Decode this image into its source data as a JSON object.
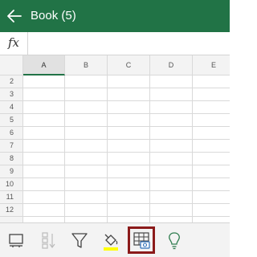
{
  "window": {
    "title": "Book (5)"
  },
  "formula_bar": {
    "fx_label": "fx",
    "value": ""
  },
  "grid": {
    "columns": [
      "A",
      "B",
      "C",
      "D",
      "E"
    ],
    "rows": [
      "2",
      "3",
      "4",
      "5",
      "6",
      "7",
      "8",
      "9",
      "10",
      "11",
      "12"
    ],
    "active_column": "A"
  },
  "toolbar": {
    "items": [
      {
        "icon": "keyboard-view-icon",
        "state": "normal"
      },
      {
        "icon": "sort-icon",
        "state": "disabled"
      },
      {
        "icon": "filter-icon",
        "state": "normal"
      },
      {
        "icon": "fill-color-icon",
        "state": "normal"
      },
      {
        "icon": "table-camera-icon",
        "state": "highlighted"
      },
      {
        "icon": "lightbulb-icon",
        "state": "normal"
      }
    ]
  },
  "colors": {
    "brand": "#217346",
    "fill_highlight": "#ffff00",
    "highlight_border": "#8b1a1a"
  }
}
